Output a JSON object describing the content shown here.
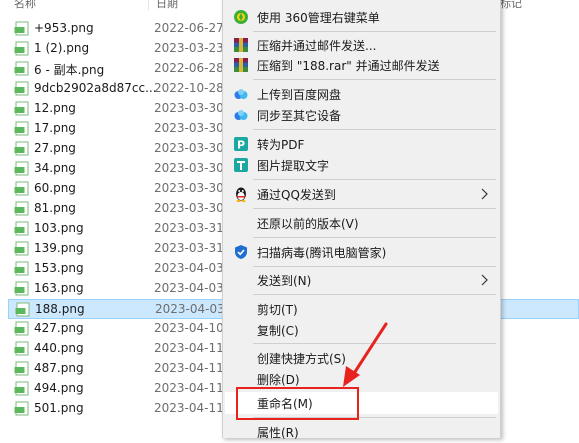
{
  "header": {
    "name_col": "名称",
    "date_col": "日期",
    "type_col": "标记"
  },
  "files": [
    {
      "name": "+953.png",
      "date": "2022-06-27"
    },
    {
      "name": "1 (2).png",
      "date": "2023-03-23"
    },
    {
      "name": "6 - 副本.png",
      "date": "2022-06-28"
    },
    {
      "name": "9dcb2902a8d87cc...",
      "date": "2022-10-28"
    },
    {
      "name": "12.png",
      "date": "2023-03-30"
    },
    {
      "name": "17.png",
      "date": "2023-03-30"
    },
    {
      "name": "27.png",
      "date": "2023-03-30"
    },
    {
      "name": "34.png",
      "date": "2023-03-30"
    },
    {
      "name": "60.png",
      "date": "2023-03-30"
    },
    {
      "name": "81.png",
      "date": "2023-03-30"
    },
    {
      "name": "103.png",
      "date": "2023-03-31"
    },
    {
      "name": "139.png",
      "date": "2023-03-31"
    },
    {
      "name": "153.png",
      "date": "2023-04-03"
    },
    {
      "name": "163.png",
      "date": "2023-04-03"
    },
    {
      "name": "188.png",
      "date": "2023-04-03"
    },
    {
      "name": "427.png",
      "date": "2023-04-10"
    },
    {
      "name": "440.png",
      "date": "2023-04-11"
    },
    {
      "name": "487.png",
      "date": "2023-04-11"
    },
    {
      "name": "494.png",
      "date": "2023-04-11"
    },
    {
      "name": "501.png",
      "date": "2023-04-11"
    }
  ],
  "selected_file": "188.png",
  "menu": {
    "item_360": "使用 360管理右键菜单",
    "compress_email": "压缩并通过邮件发送...",
    "compress_rar_email": "压缩到 \"188.rar\" 并通过邮件发送",
    "upload_baidu": "上传到百度网盘",
    "sync_devices": "同步至其它设备",
    "to_pdf": "转为PDF",
    "extract_text": "图片提取文字",
    "send_qq": "通过QQ发送到",
    "restore_version": "还原以前的版本(V)",
    "scan_virus": "扫描病毒(腾讯电脑管家)",
    "send_to": "发送到(N)",
    "cut": "剪切(T)",
    "copy": "复制(C)",
    "create_shortcut": "创建快捷方式(S)",
    "delete": "删除(D)",
    "rename": "重命名(M)",
    "properties": "属性(R)"
  },
  "colors": {
    "accent_red": "#e8231e",
    "selection": "#cce8ff",
    "png_icon_green": "#5cb85c"
  }
}
